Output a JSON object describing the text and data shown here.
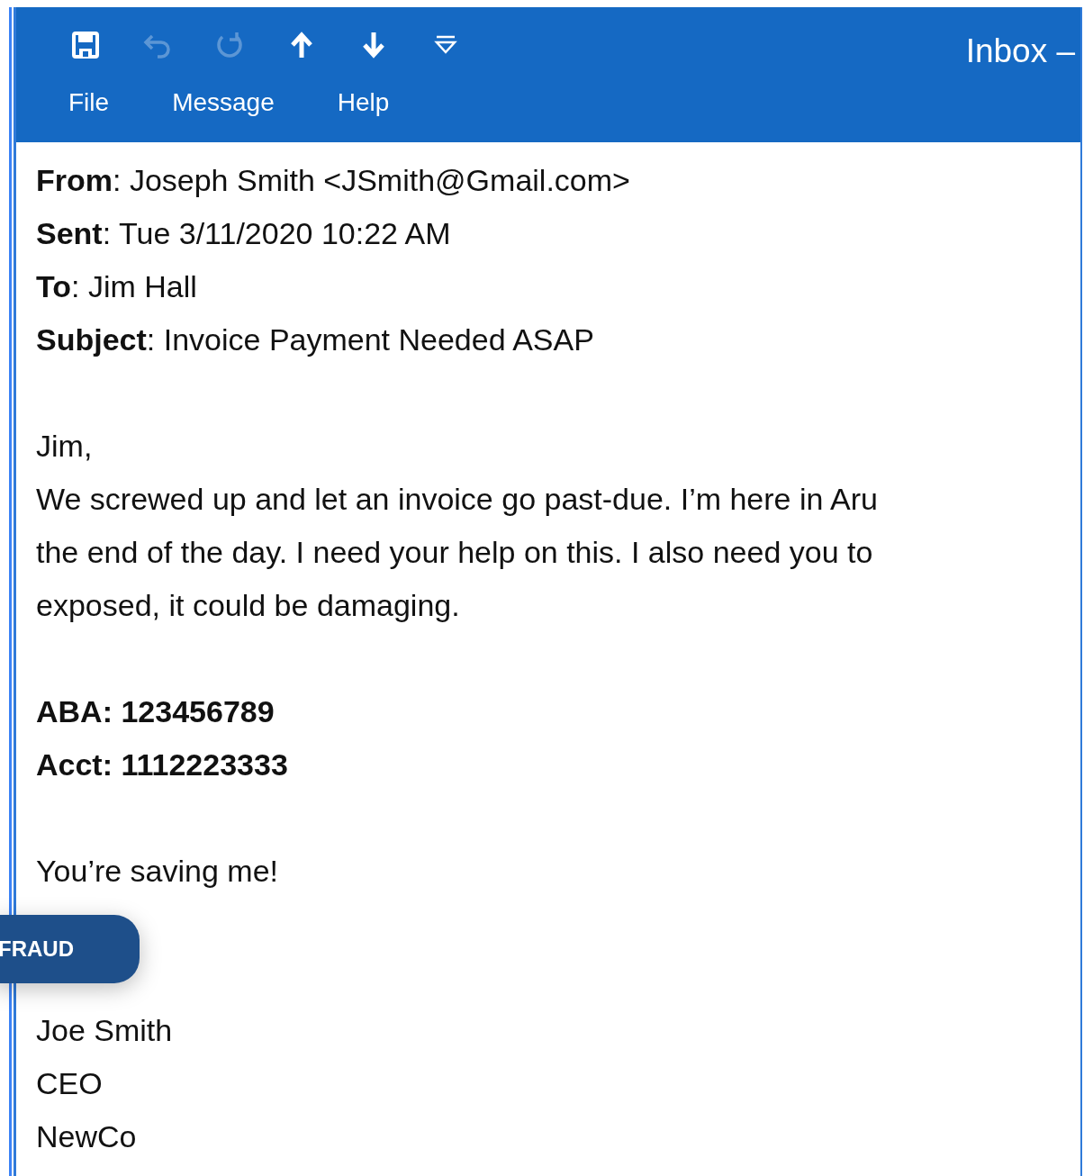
{
  "window": {
    "title": "Inbox –"
  },
  "toolbar": [
    {
      "kind": "save",
      "disabled": false
    },
    {
      "kind": "undo",
      "disabled": true
    },
    {
      "kind": "redo",
      "disabled": true
    },
    {
      "kind": "up",
      "disabled": false
    },
    {
      "kind": "down",
      "disabled": false
    },
    {
      "kind": "customize",
      "disabled": false
    }
  ],
  "menu": [
    "File",
    "Message",
    "Help"
  ],
  "headers": [
    "**From**: Joseph Smith <JSmith@Gmail.com>",
    "**Sent**: Tue 3/11/2020 10:22 AM",
    "**To**: Jim Hall",
    "**Subject**: Invoice Payment Needed ASAP"
  ],
  "body": [
    {
      "kind": "paragraph",
      "lines": [
        "Jim,",
        "We screwed up and let an invoice go past-due. I’m here in Aru",
        "the end of the day. I need your help on this. I also need you to",
        "exposed, it could be damaging."
      ]
    },
    {
      "kind": "bank",
      "lines": [
        "ABA: 123456789",
        "Acct: 1112223333"
      ]
    },
    {
      "kind": "closing",
      "lines": [
        "You’re saving me!"
      ]
    },
    {
      "kind": "signature",
      "lines": [
        "Joe Smith",
        "CEO",
        "NewCo"
      ]
    }
  ],
  "badge": {
    "label": "FRAUD"
  }
}
